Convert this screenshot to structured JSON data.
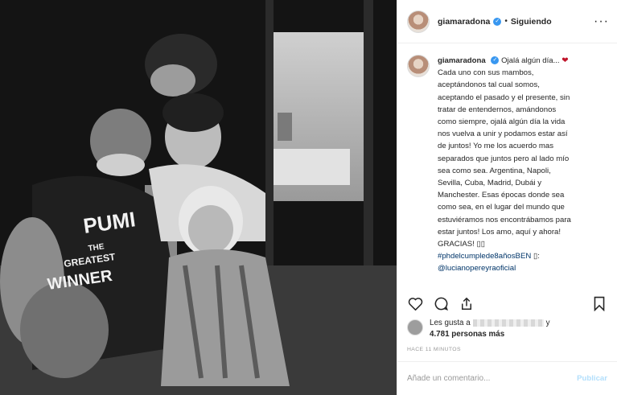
{
  "post": {
    "photo_alt": "Foto en blanco y negro de una familia abrazada",
    "shirt_text": [
      "PUMI",
      "THE",
      "GREATEST",
      "WINNER"
    ]
  },
  "header": {
    "username": "giamaradona",
    "verified_icon": "verified-badge-icon",
    "separator": "•",
    "follow_status": "Siguiendo",
    "more_icon": "ellipsis-icon",
    "more_label": "···"
  },
  "caption": {
    "username": "giamaradona",
    "first": "Ojalá algún día...",
    "heart": "❤",
    "lines": [
      "Cada uno con sus mambos,",
      "aceptándonos tal cual somos,",
      "aceptando el pasado y el presente, sin",
      "tratar de entendernos, amándonos",
      "como siempre, ojalá algún día la vida",
      "nos vuelva a unir y podamos estar así",
      "de juntos! Yo me los acuerdo mas",
      "separados que juntos pero al lado mío",
      "sea como sea. Argentina, Napoli,",
      "Sevilla, Cuba, Madrid, Dubái y",
      "Manchester. Esas épocas donde sea",
      "como sea, en el lugar del mundo que",
      "estuviéramos nos encontrábamos para",
      "estar juntos! Los amo, aquí y ahora!",
      "GRACIAS! ▯▯"
    ],
    "hashtag": "#phdelcumplede8añosBEN",
    "hashtag_suffix": " ▯:",
    "mention": "@lucianopereyraoficial"
  },
  "actions": {
    "like_icon": "heart-outline-icon",
    "comment_icon": "comment-icon",
    "share_icon": "share-icon",
    "save_icon": "bookmark-icon"
  },
  "likes": {
    "prefix": "Les gusta a",
    "suffix": "y",
    "count": "4.781",
    "count_label": "personas más"
  },
  "timestamp": "HACE 11 MINUTOS",
  "comment_box": {
    "placeholder": "Añade un comentario...",
    "publish_label": "Publicar"
  },
  "colors": {
    "verified": "#3897f0",
    "link": "#003569",
    "heart": "#c0152b",
    "publish_disabled": "#b2dffc"
  }
}
